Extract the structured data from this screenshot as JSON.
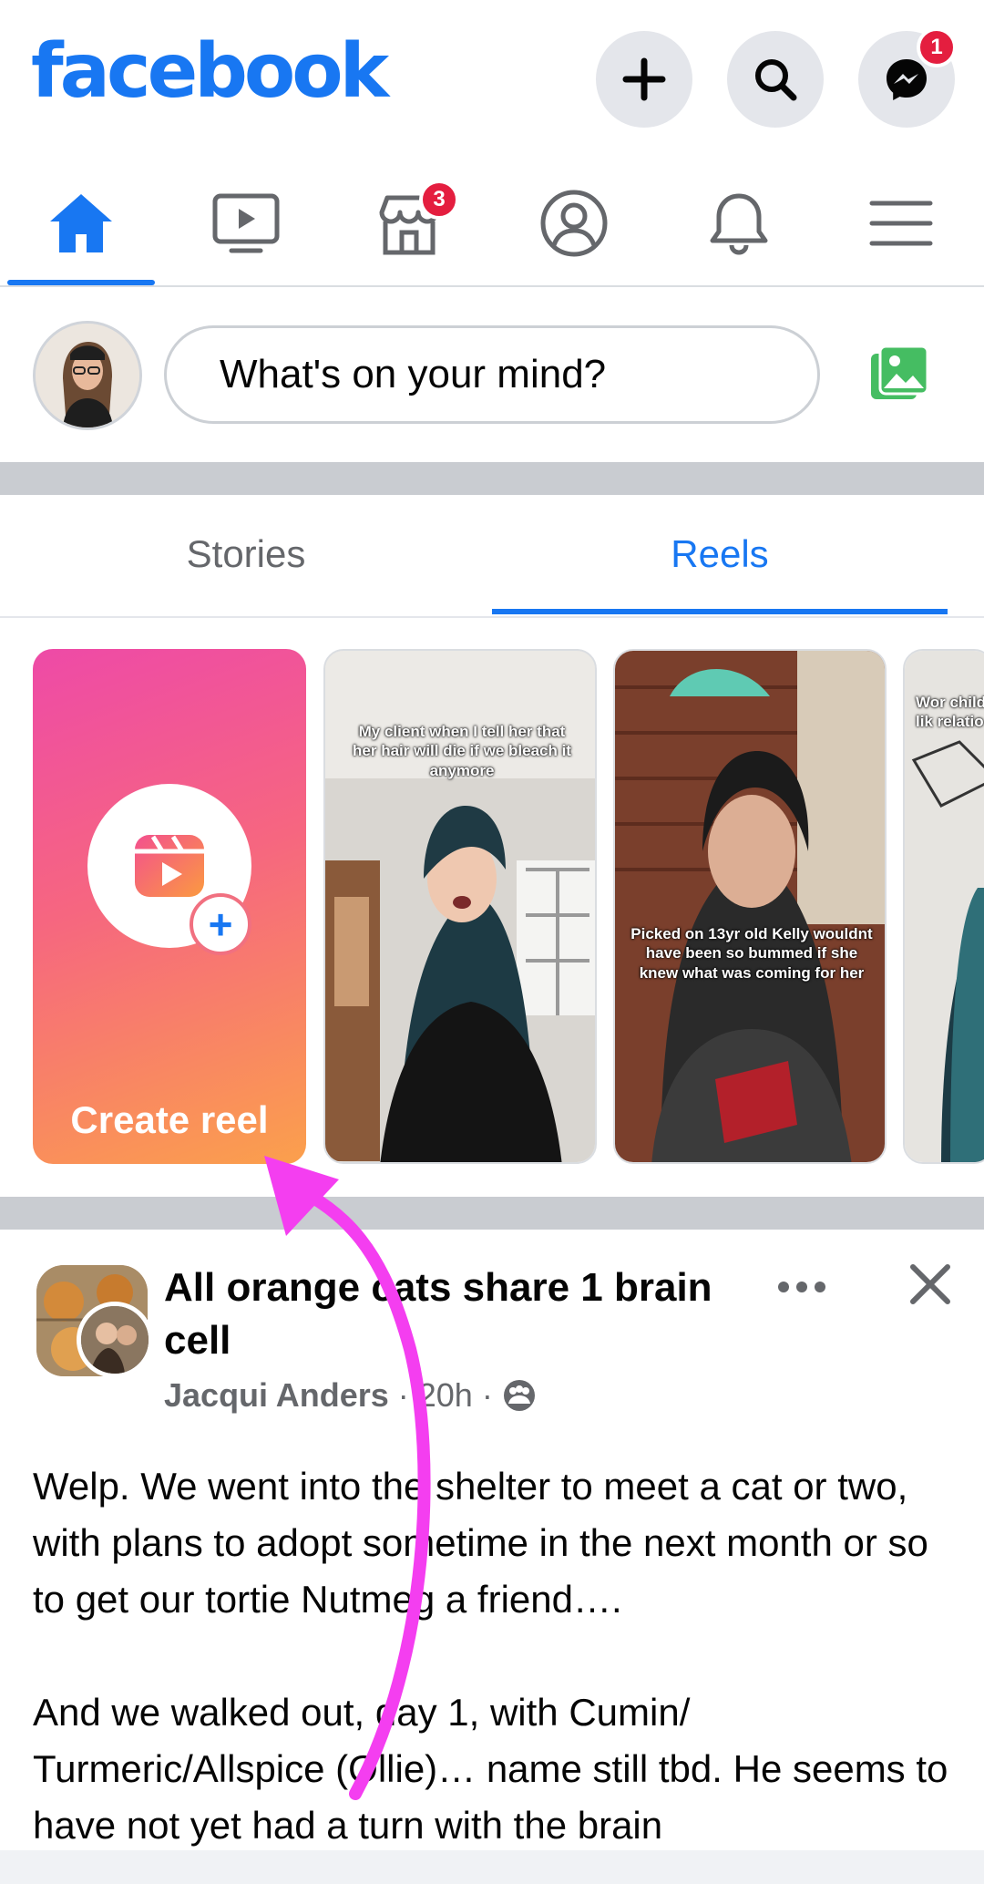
{
  "header": {
    "logo": "facebook",
    "messenger_badge": "1"
  },
  "nav": {
    "marketplace_badge": "3",
    "active_tab": "home"
  },
  "composer": {
    "placeholder": "What's on your mind?"
  },
  "tabs": [
    {
      "label": "Stories",
      "active": false
    },
    {
      "label": "Reels",
      "active": true
    }
  ],
  "reels": {
    "create_label": "Create reel",
    "captions": [
      "My client when I tell her that her hair will die if we bleach it anymore",
      "Picked on 13yr old Kelly wouldnt have been so bummed if she knew what was coming for her",
      "Wor childho lik relatio"
    ]
  },
  "post": {
    "group_name": "All orange cats share 1 brain cell",
    "author": "Jacqui Anders",
    "time": "20h",
    "separator": "·",
    "paragraphs": [
      "Welp. We went into the shelter to meet a cat or two, with plans to adopt sometime in the next month or so to get our tortie Nutmeg a friend….",
      "And we walked out, day 1, with Cumin/ Turmeric/Allspice (Ollie)… name still tbd. He seems to have not yet had a turn with the brain"
    ]
  },
  "colors": {
    "brand": "#1877f2",
    "badge": "#e41e3f",
    "annotation_arrow": "#f43ef0"
  }
}
